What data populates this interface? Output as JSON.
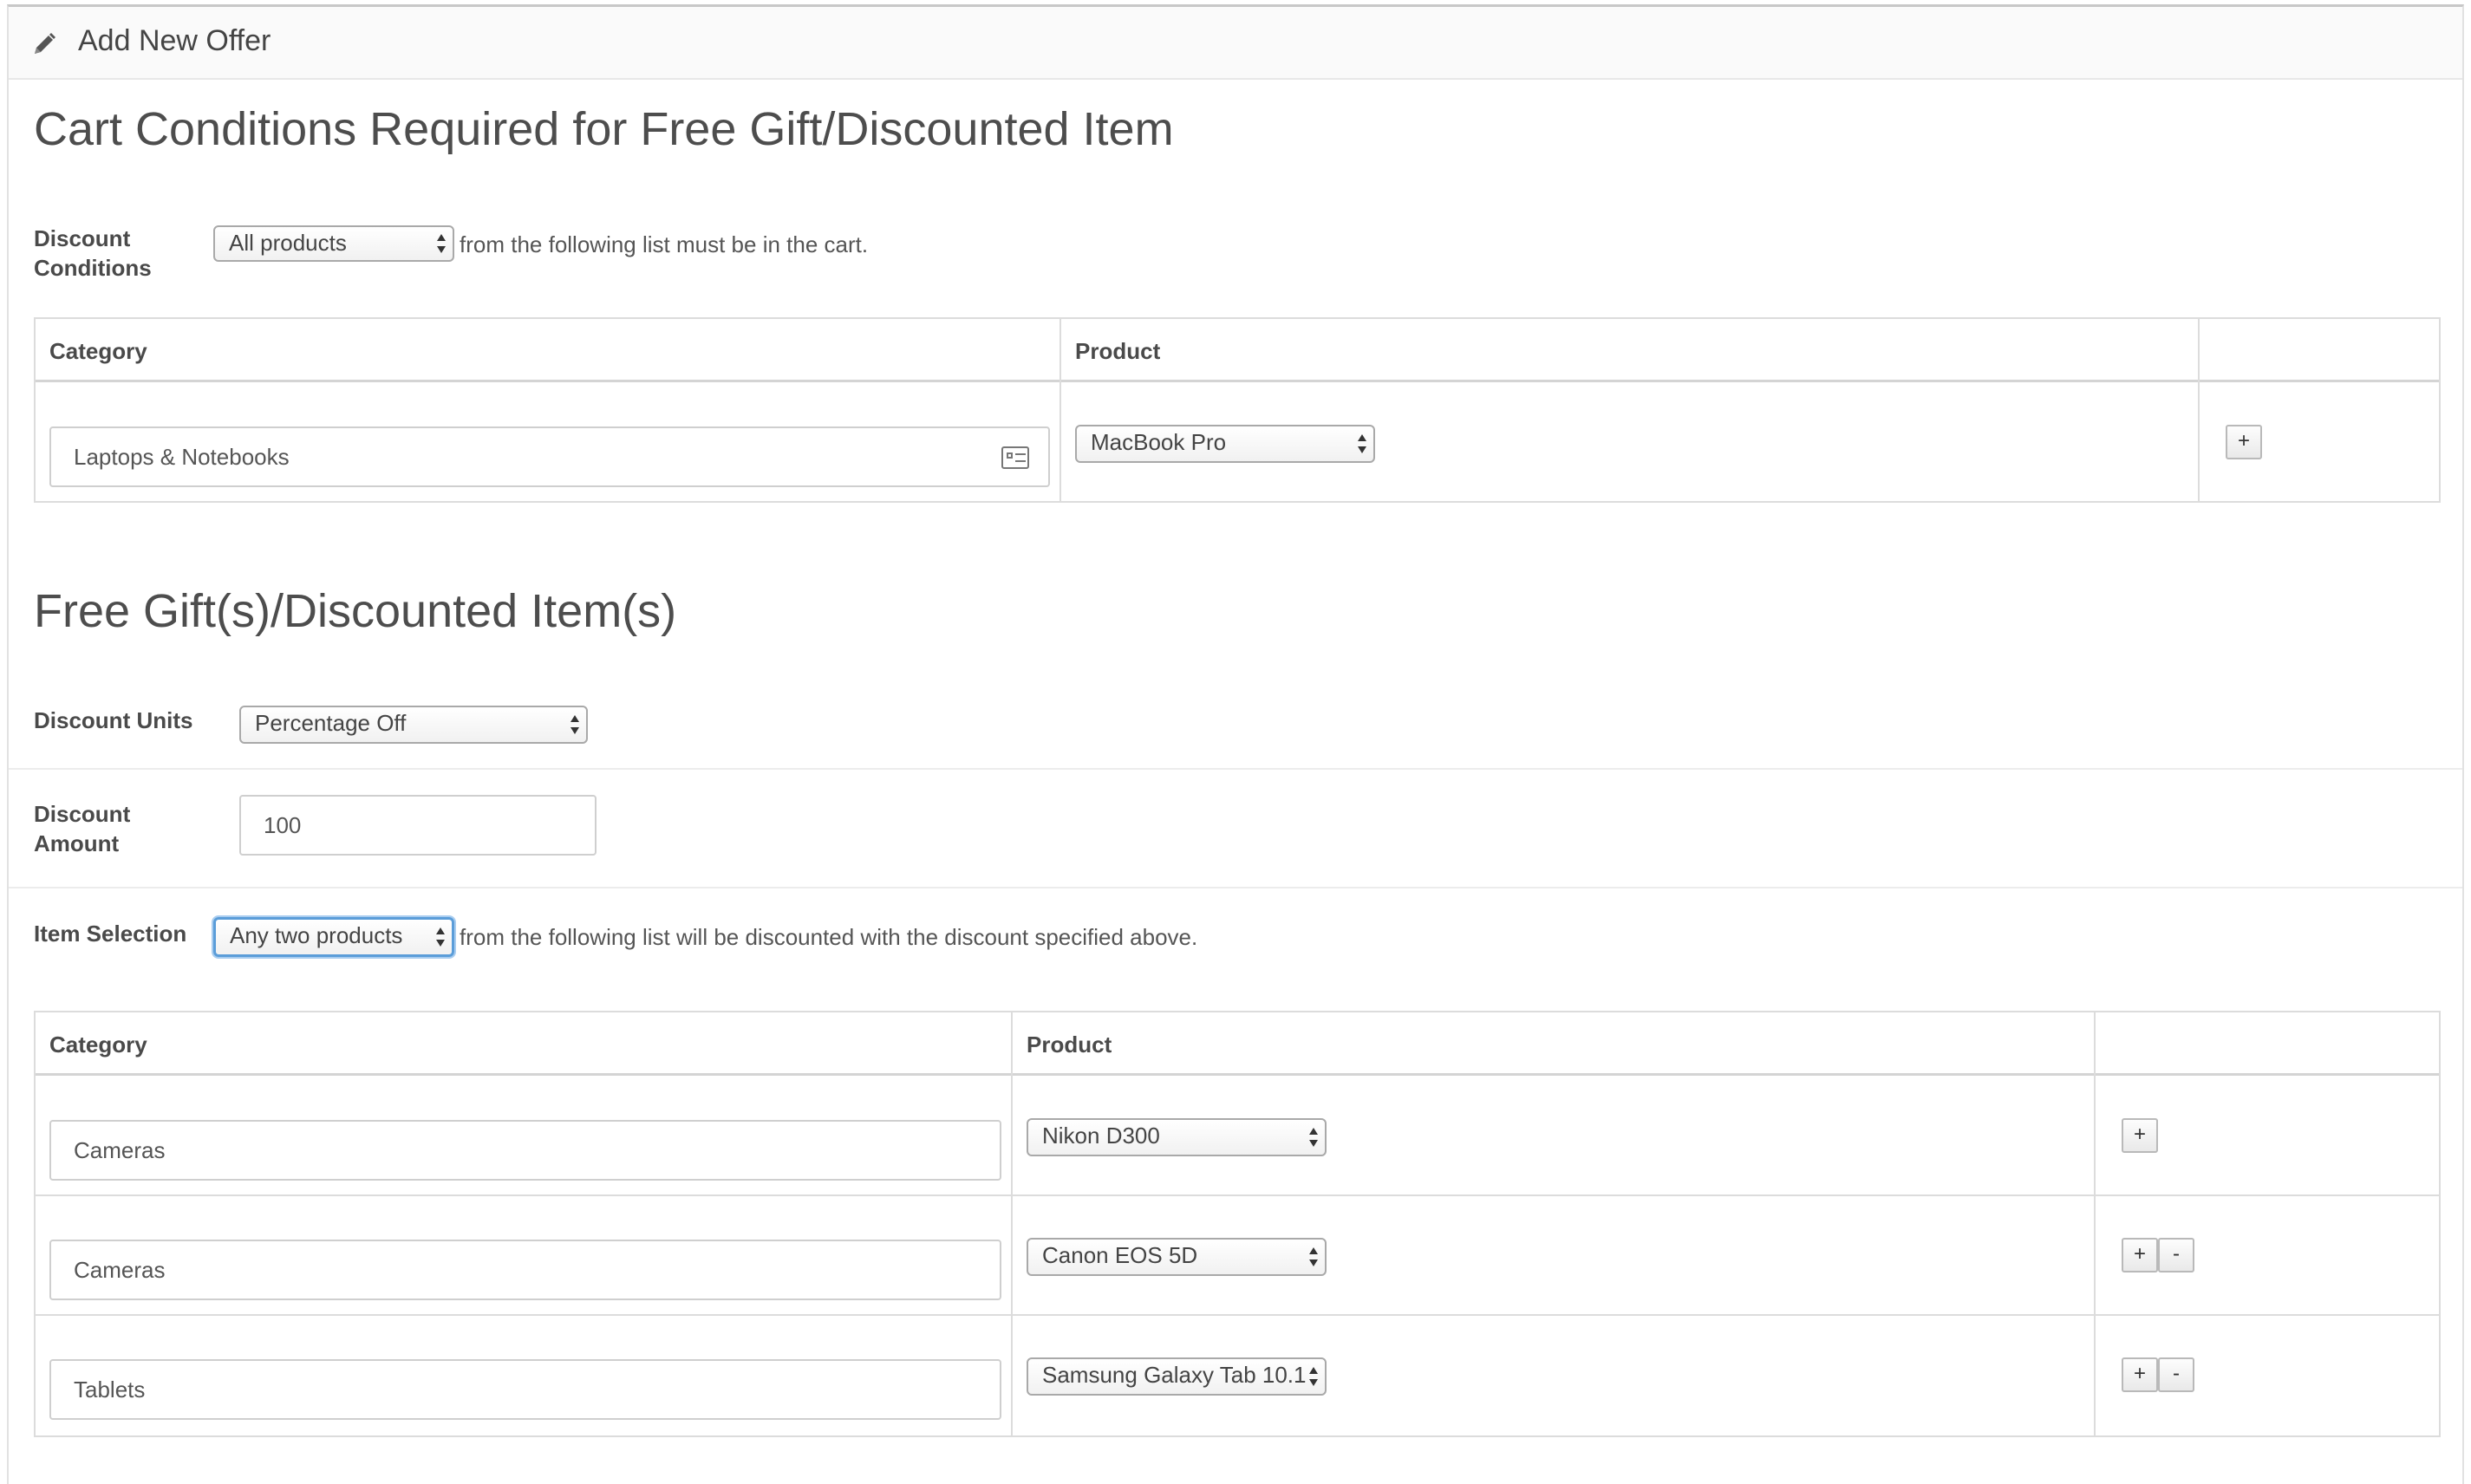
{
  "header": {
    "title": "Add New Offer",
    "icon": "pencil-icon"
  },
  "conditions": {
    "heading": "Cart Conditions Required for Free Gift/Discounted Item",
    "discount_conditions_label_line1": "Discount",
    "discount_conditions_label_line2": "Conditions",
    "discount_conditions_value": "All products",
    "discount_conditions_text": "from the following list must be in the cart.",
    "table": {
      "col_category": "Category",
      "col_product": "Product",
      "rows": [
        {
          "category": "Laptops & Notebooks",
          "product": "MacBook Pro",
          "add": "+"
        }
      ]
    }
  },
  "gifts": {
    "heading": "Free Gift(s)/Discounted Item(s)",
    "discount_units_label": "Discount Units",
    "discount_units_value": "Percentage Off",
    "discount_amount_label_line1": "Discount",
    "discount_amount_label_line2": "Amount",
    "discount_amount_value": "100",
    "item_selection_label": "Item Selection",
    "item_selection_value": "Any two products",
    "item_selection_text": "from the following list will be discounted with the discount specified above.",
    "table": {
      "col_category": "Category",
      "col_product": "Product",
      "rows": [
        {
          "category": "Cameras",
          "product": "Nikon D300",
          "add": "+",
          "remove": ""
        },
        {
          "category": "Cameras",
          "product": "Canon EOS 5D",
          "add": "+",
          "remove": "-"
        },
        {
          "category": "Tablets",
          "product": "Samsung Galaxy Tab 10.1",
          "add": "+",
          "remove": "-"
        }
      ]
    }
  },
  "colors": {
    "focus_border": "#5b9dd9",
    "text": "#4a4a4a",
    "border": "#dcdcdc"
  }
}
